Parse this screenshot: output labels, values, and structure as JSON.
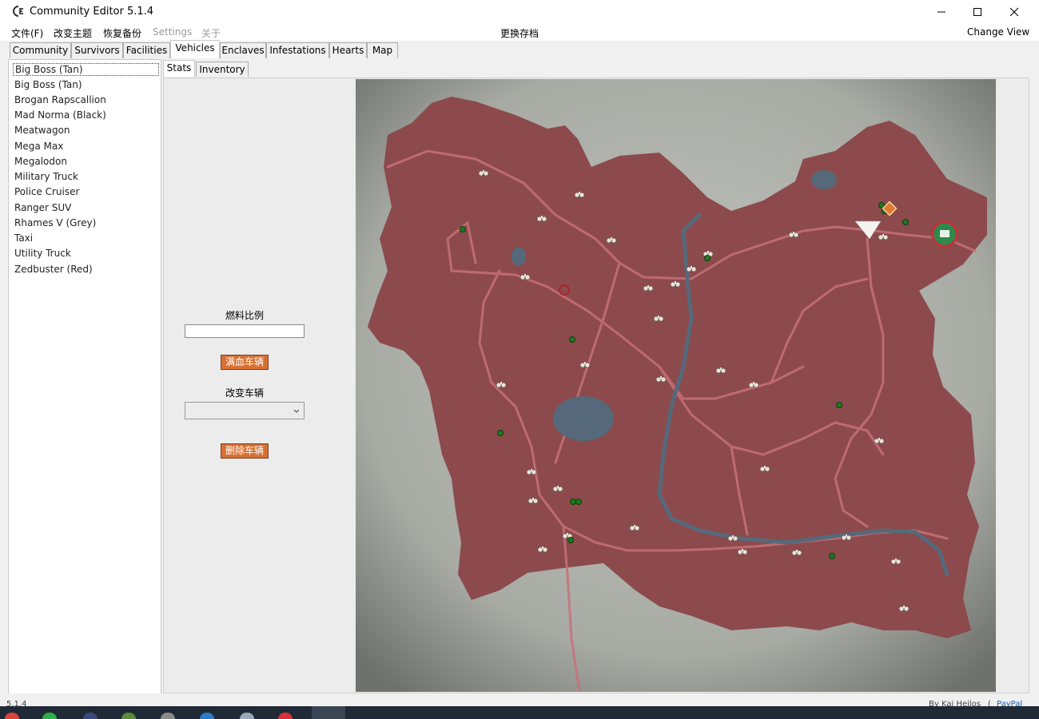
{
  "window": {
    "title": "Community Editor 5.1.4",
    "accent": "#d87033"
  },
  "menu": {
    "file": "文件(F)",
    "theme": "改变主题",
    "restore": "恢复备份",
    "settings": "Settings",
    "about": "关于",
    "switch_save": "更换存档",
    "change_view": "Change View"
  },
  "tabs": [
    "Community",
    "Survivors",
    "Facilities",
    "Vehicles",
    "Enclaves",
    "Infestations",
    "Hearts",
    "Map"
  ],
  "active_tab": "Vehicles",
  "vehicles": [
    "Big Boss (Tan)",
    "Big Boss (Tan)",
    "Brogan Rapscallion",
    "Mad Norma (Black)",
    "Meatwagon",
    "Mega Max",
    "Megalodon",
    "Military Truck",
    "Police Cruiser",
    "Ranger SUV",
    "Rhames V (Grey)",
    "Taxi",
    "Utility Truck",
    "Zedbuster (Red)"
  ],
  "subtabs": [
    "Stats",
    "Inventory"
  ],
  "stats": {
    "fuel_label": "燃料比例",
    "fuel_value": "",
    "heal_button": "满血车辆",
    "change_label": "改变车辆",
    "change_value": "",
    "delete_button": "删除车辆"
  },
  "map": {
    "land_color": "#8c4a4c",
    "road_color": "#c9707a",
    "water_color": "#55697a",
    "marker_color": "#1e7a1e"
  },
  "statusbar": {
    "version": "5.1.4",
    "credit": "By Kai Heilos",
    "paypal": "PayPal"
  }
}
